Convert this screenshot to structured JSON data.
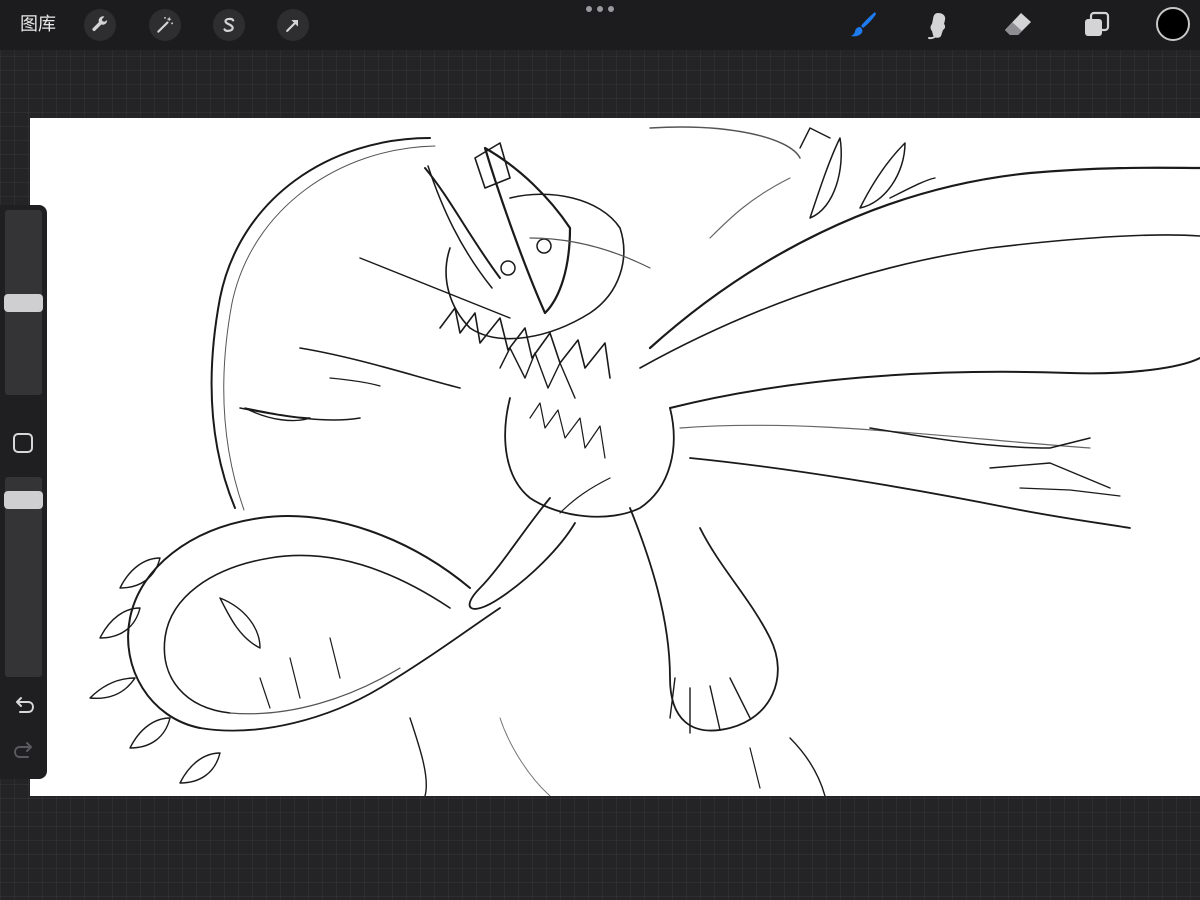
{
  "topbar": {
    "gallery_label": "图库",
    "left_tools": [
      {
        "icon": "wrench-icon",
        "name": "actions"
      },
      {
        "icon": "magic-wand-icon",
        "name": "adjustments"
      },
      {
        "icon": "selection-s-icon",
        "name": "selection"
      },
      {
        "icon": "arrow-cursor-icon",
        "name": "transform"
      }
    ],
    "right_tools": [
      {
        "icon": "brush-icon",
        "name": "paint",
        "active": true
      },
      {
        "icon": "smudge-icon",
        "name": "smudge"
      },
      {
        "icon": "eraser-icon",
        "name": "eraser"
      },
      {
        "icon": "layers-icon",
        "name": "layers"
      }
    ],
    "current_color": "#000000"
  },
  "sidebar": {
    "brush_size_level": 0.5,
    "brush_opacity_level": 0.95,
    "undo_icon": "undo-arrow-icon",
    "redo_icon": "redo-arrow-icon"
  },
  "colors": {
    "accent": "#1e7cf2",
    "toolbar_bg": "#1c1c1e",
    "canvas_bg": "#ffffff"
  }
}
